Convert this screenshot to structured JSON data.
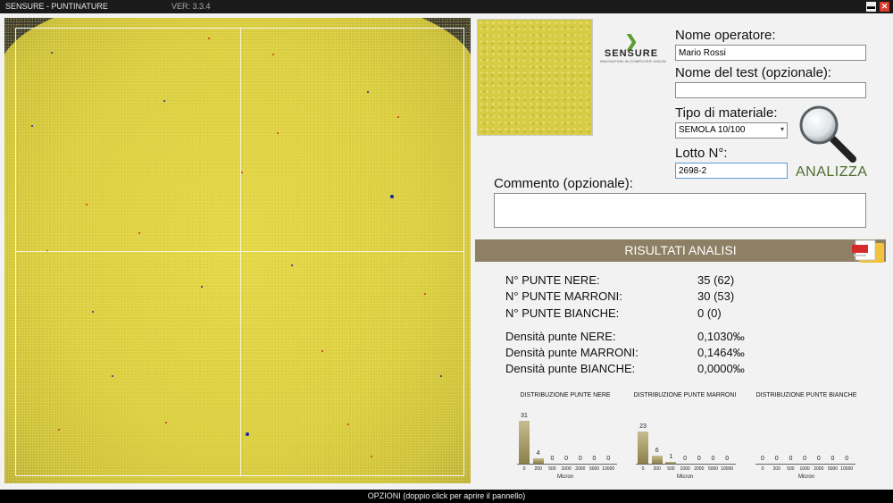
{
  "window": {
    "title": "SENSURE - PUNTINATURE",
    "version": "VER: 3.3.4",
    "minimize": "▬",
    "close": "✕"
  },
  "logo": {
    "brand": "SENSURE",
    "tagline": "INNOVATION IN COMPUTER VISION"
  },
  "form": {
    "operator_label": "Nome operatore:",
    "operator_value": "Mario Rossi",
    "test_label": "Nome del test (opzionale):",
    "test_value": "",
    "material_label": "Tipo di materiale:",
    "material_value": "SEMOLA 10/100",
    "lot_label": "Lotto N°:",
    "lot_value": "2698-2",
    "comment_label": "Commento (opzionale):",
    "comment_value": ""
  },
  "analyze": {
    "label": "ANALIZZA"
  },
  "results": {
    "header": "RISULTATI ANALISI",
    "rows": [
      {
        "label": "N° PUNTE NERE:",
        "value": "35 (62)"
      },
      {
        "label": "N° PUNTE MARRONI:",
        "value": "30 (53)"
      },
      {
        "label": "N° PUNTE BIANCHE:",
        "value": "0 (0)"
      },
      {
        "label": "Densità punte NERE:",
        "value": "0,1030‰"
      },
      {
        "label": "Densità punte MARRONI:",
        "value": "0,1464‰"
      },
      {
        "label": "Densità punte BIANCHE:",
        "value": "0,0000‰"
      }
    ]
  },
  "chart_data": [
    {
      "type": "bar",
      "title": "DISTRIBUZIONE PUNTE NERE",
      "xlabel": "Micron",
      "categories": [
        "0",
        "200",
        "500",
        "1000",
        "2000",
        "5000",
        "10000"
      ],
      "values": [
        31,
        4,
        0,
        0,
        0,
        0,
        0
      ]
    },
    {
      "type": "bar",
      "title": "DISTRIBUZIONE PUNTE MARRONI",
      "xlabel": "Micron",
      "categories": [
        "0",
        "200",
        "500",
        "1000",
        "2000",
        "5000",
        "10000"
      ],
      "values": [
        23,
        6,
        1,
        0,
        0,
        0,
        0
      ]
    },
    {
      "type": "bar",
      "title": "DISTRIBUZIONE PUNTE BIANCHE",
      "xlabel": "Micron",
      "categories": [
        "0",
        "200",
        "500",
        "1000",
        "2000",
        "5000",
        "10000"
      ],
      "values": [
        0,
        0,
        0,
        0,
        0,
        0,
        0
      ]
    }
  ],
  "footer": {
    "options_label": "OPZIONI (doppio click per aprire il pannello)"
  }
}
